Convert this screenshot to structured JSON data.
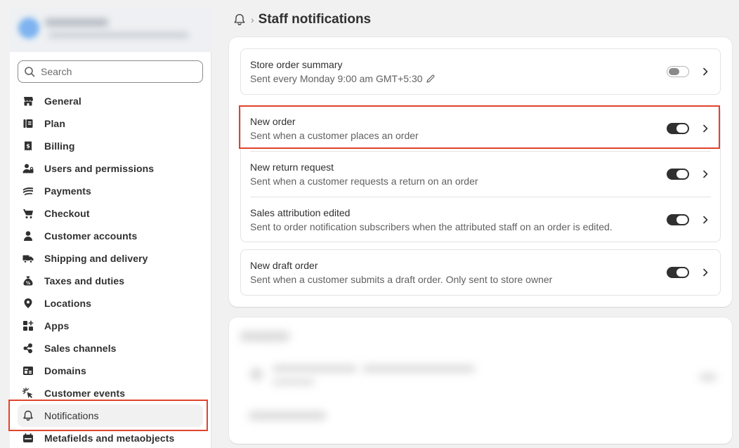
{
  "sidebar": {
    "search": {
      "placeholder": "Search"
    },
    "items": [
      {
        "label": "General",
        "icon": "store-icon"
      },
      {
        "label": "Plan",
        "icon": "plan-icon"
      },
      {
        "label": "Billing",
        "icon": "receipt-icon"
      },
      {
        "label": "Users and permissions",
        "icon": "users-icon"
      },
      {
        "label": "Payments",
        "icon": "payments-icon"
      },
      {
        "label": "Checkout",
        "icon": "cart-icon"
      },
      {
        "label": "Customer accounts",
        "icon": "person-icon"
      },
      {
        "label": "Shipping and delivery",
        "icon": "truck-icon"
      },
      {
        "label": "Taxes and duties",
        "icon": "tax-bag-icon"
      },
      {
        "label": "Locations",
        "icon": "location-pin-icon"
      },
      {
        "label": "Apps",
        "icon": "apps-grid-icon"
      },
      {
        "label": "Sales channels",
        "icon": "sales-channels-icon"
      },
      {
        "label": "Domains",
        "icon": "domains-icon"
      },
      {
        "label": "Customer events",
        "icon": "cursor-click-icon"
      },
      {
        "label": "Notifications",
        "icon": "bell-icon",
        "active": true
      },
      {
        "label": "Metafields and metaobjects",
        "icon": "metafields-icon"
      }
    ]
  },
  "header": {
    "separator": "›",
    "title": "Staff notifications"
  },
  "notifications": {
    "groups": [
      {
        "rows": [
          {
            "name": "Store order summary",
            "description": "Sent every Monday 9:00 am GMT+5:30",
            "enabled": false,
            "editable": true
          }
        ]
      },
      {
        "rows": [
          {
            "name": "New order",
            "description": "Sent when a customer places an order",
            "enabled": true
          },
          {
            "name": "New return request",
            "description": "Sent when a customer requests a return on an order",
            "enabled": true
          },
          {
            "name": "Sales attribution edited",
            "description": "Sent to order notification subscribers when the attributed staff on an order is edited.",
            "enabled": true
          }
        ]
      },
      {
        "rows": [
          {
            "name": "New draft order",
            "description": "Sent when a customer submits a draft order. Only sent to store owner",
            "enabled": true
          }
        ]
      }
    ]
  },
  "colors": {
    "highlight": "#e0442c",
    "toggle_on": "#303030",
    "background": "#f1f1f1"
  }
}
